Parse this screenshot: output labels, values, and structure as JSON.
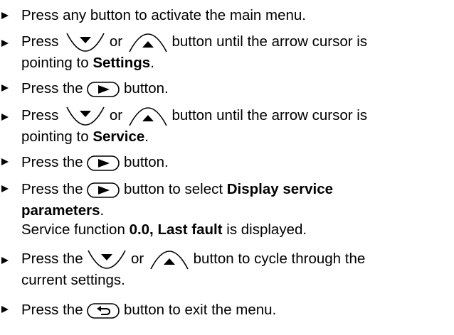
{
  "steps": [
    {
      "lines": [
        {
          "segments": [
            "Press any button to activate the main menu."
          ]
        }
      ]
    },
    {
      "press": "Press",
      "or": "or",
      "after": "button until the arrow cursor is",
      "line2_pre": "pointing to ",
      "line2_bold": "Settings",
      "line2_post": "."
    },
    {
      "pre": "Press the",
      "post": "button."
    },
    {
      "press": "Press",
      "or": "or",
      "after": "button until the arrow cursor is",
      "line2_pre": "pointing to ",
      "line2_bold": "Service",
      "line2_post": "."
    },
    {
      "pre": "Press the",
      "post": "button."
    },
    {
      "pre": "Press the",
      "post": "button to select ",
      "bold1": "Display service",
      "bold2": "parameters",
      "post2": ".",
      "note_pre": "Service function ",
      "note_bold": "0.0, Last fault",
      "note_post": " is displayed."
    },
    {
      "pre": "Press the",
      "or": "or",
      "after": "button to cycle through the",
      "line2": "current settings."
    },
    {
      "pre": "Press the",
      "post": "button to exit the menu."
    }
  ],
  "icons": {
    "down": "down-arrow-button-icon",
    "up": "up-arrow-button-icon",
    "right": "right-arrow-button-icon",
    "back": "back-return-button-icon"
  }
}
